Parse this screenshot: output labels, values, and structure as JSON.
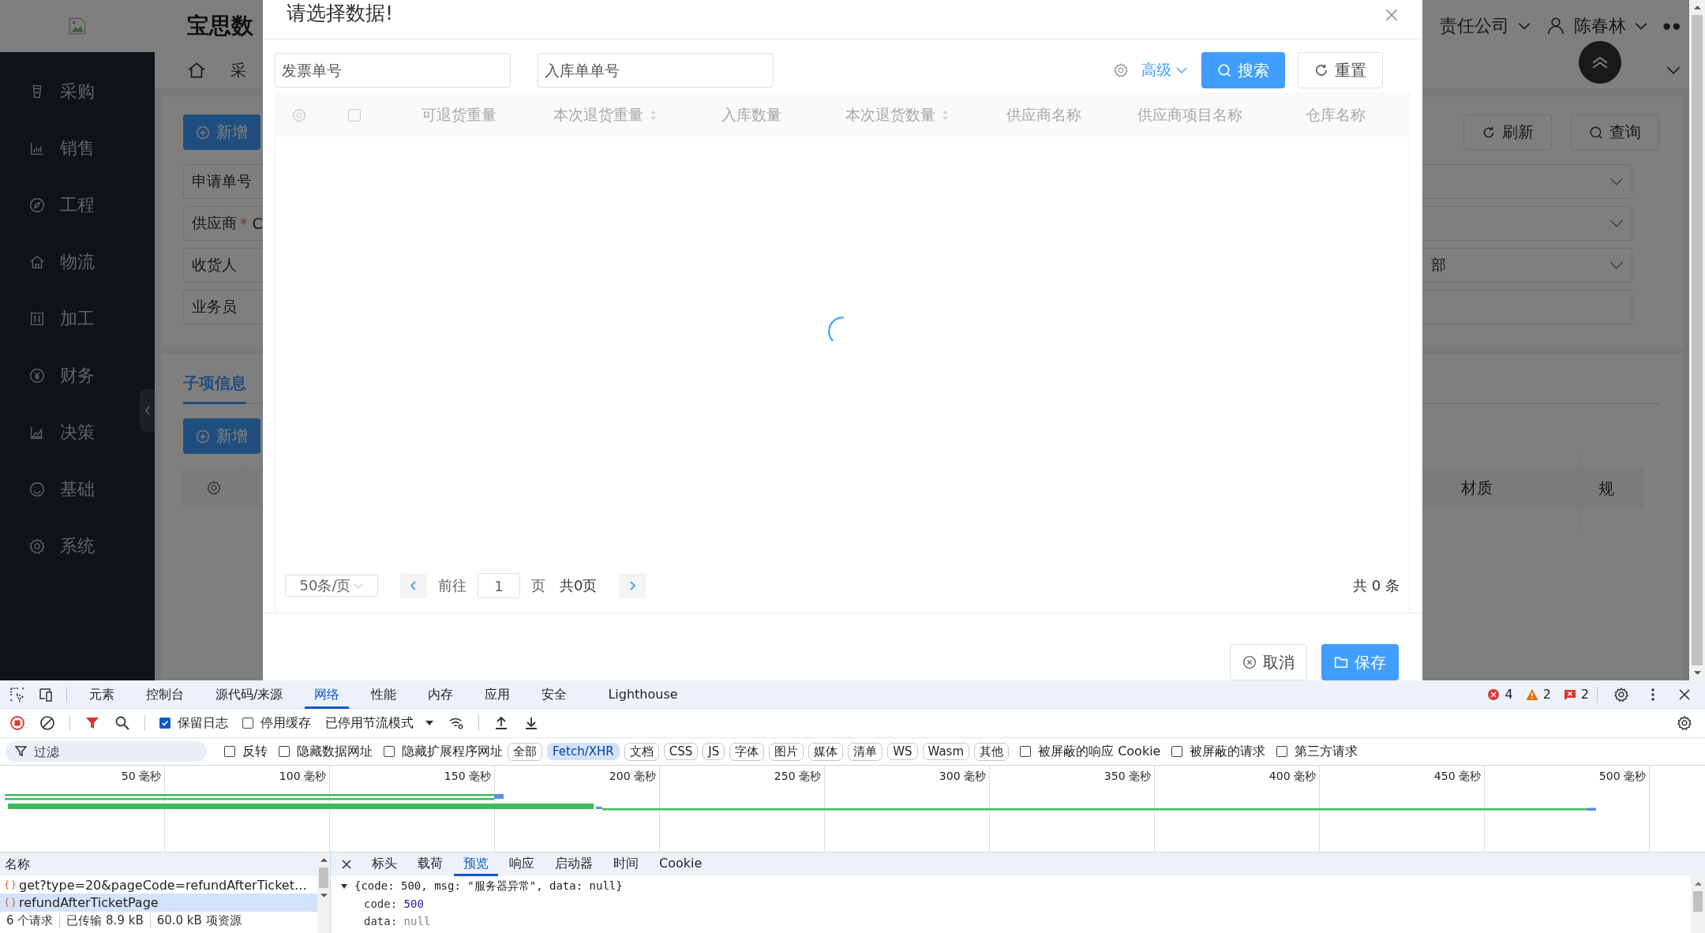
{
  "app": {
    "header": {
      "title": "宝思数",
      "company": "责任公司",
      "user": "陈春林"
    },
    "sidebar": {
      "items": [
        {
          "label": "采购"
        },
        {
          "label": "销售"
        },
        {
          "label": "工程"
        },
        {
          "label": "物流"
        },
        {
          "label": "加工"
        },
        {
          "label": "财务"
        },
        {
          "label": "决策"
        },
        {
          "label": "基础"
        },
        {
          "label": "系统"
        }
      ]
    },
    "tabs_bar": {
      "tabs": [
        {
          "label": "采"
        }
      ]
    },
    "form": {
      "add_button": "新增",
      "refresh_button": "刷新",
      "query_button": "查询",
      "required_mark": "*",
      "fields": [
        {
          "label": "申请单号",
          "required": false
        },
        {
          "label": "供应商",
          "required": true,
          "value": "C"
        },
        {
          "label": "收货人",
          "required": false
        },
        {
          "label": "业务员",
          "required": false
        }
      ],
      "right_fields": [
        {
          "kind": "select"
        },
        {
          "kind": "select"
        },
        {
          "kind": "select",
          "value": "部"
        },
        {
          "kind": "input"
        }
      ]
    },
    "sub_section": {
      "tabs": [
        {
          "label": "子项信息",
          "selected": true
        }
      ],
      "add_button": "新增",
      "columns": [
        "材质",
        "规"
      ]
    }
  },
  "dialog": {
    "title": "请选择数据!",
    "filters": [
      {
        "placeholder": "发票单号"
      },
      {
        "placeholder": "入库单单号"
      }
    ],
    "advanced": "高级",
    "search_button": "搜索",
    "reset_button": "重置",
    "table": {
      "loading": true,
      "select_all_checked": false,
      "columns": [
        {
          "label": "可退货重量",
          "sortable": false
        },
        {
          "label": "本次退货重量",
          "sortable": true
        },
        {
          "label": "入库数量",
          "sortable": false
        },
        {
          "label": "本次退货数量",
          "sortable": true
        },
        {
          "label": "供应商名称",
          "sortable": false
        },
        {
          "label": "供应商项目名称",
          "sortable": false
        },
        {
          "label": "仓库名称",
          "sortable": false
        }
      ]
    },
    "pagination": {
      "page_size": "50条/页",
      "goto": "前往",
      "page": "1",
      "page_unit": "页",
      "page_count": "共0页",
      "total": "共 0 条"
    },
    "buttons": [
      {
        "label": "取消",
        "kind": "default"
      },
      {
        "label": "保存",
        "kind": "primary"
      }
    ]
  },
  "devtools": {
    "tabs": [
      {
        "label": "元素",
        "selected": false
      },
      {
        "label": "控制台",
        "selected": false
      },
      {
        "label": "源代码/来源",
        "selected": false
      },
      {
        "label": "网络",
        "selected": true
      },
      {
        "label": "性能",
        "selected": false
      },
      {
        "label": "内存",
        "selected": false
      },
      {
        "label": "应用",
        "selected": false
      },
      {
        "label": "安全",
        "selected": false
      },
      {
        "label": "Lighthouse",
        "selected": false
      }
    ],
    "counts": {
      "errors": "4",
      "warnings": "2",
      "issues": "2"
    },
    "toolbar": {
      "options": [
        {
          "label": "保留日志",
          "checked": true
        },
        {
          "label": "停用缓存",
          "checked": false
        }
      ],
      "throttling": "已停用节流模式"
    },
    "filter": {
      "placeholder": "过滤",
      "options": [
        {
          "label": "反转",
          "checked": false
        },
        {
          "label": "隐藏数据网址",
          "checked": false
        },
        {
          "label": "隐藏扩展程序网址",
          "checked": false
        }
      ],
      "types": [
        {
          "label": "全部",
          "selected": false
        },
        {
          "label": "Fetch/XHR",
          "selected": true
        },
        {
          "label": "文档",
          "selected": false
        },
        {
          "label": "CSS",
          "selected": false
        },
        {
          "label": "JS",
          "selected": false
        },
        {
          "label": "字体",
          "selected": false
        },
        {
          "label": "图片",
          "selected": false
        },
        {
          "label": "媒体",
          "selected": false
        },
        {
          "label": "清单",
          "selected": false
        },
        {
          "label": "WS",
          "selected": false
        },
        {
          "label": "Wasm",
          "selected": false
        },
        {
          "label": "其他",
          "selected": false
        }
      ],
      "more_options": [
        {
          "label": "被屏蔽的响应 Cookie",
          "checked": false
        },
        {
          "label": "被屏蔽的请求",
          "checked": false
        },
        {
          "label": "第三方请求",
          "checked": false
        }
      ]
    },
    "timeline": {
      "ticks": [
        "50 毫秒",
        "100 毫秒",
        "150 毫秒",
        "200 毫秒",
        "250 毫秒",
        "300 毫秒",
        "350 毫秒",
        "400 毫秒",
        "450 毫秒",
        "500 毫秒"
      ]
    },
    "requests": {
      "header": "名称",
      "rows": [
        {
          "name": "get?type=20&pageCode=refundAfterTicket…",
          "selected": false
        },
        {
          "name": "refundAfterTicketPage",
          "selected": true
        }
      ],
      "summary": [
        "6 个请求",
        "已传输 8.9 kB",
        "60.0 kB 项资源"
      ]
    },
    "detail": {
      "tabs": [
        {
          "label": "标头",
          "selected": false
        },
        {
          "label": "载荷",
          "selected": false
        },
        {
          "label": "预览",
          "selected": true
        },
        {
          "label": "响应",
          "selected": false
        },
        {
          "label": "启动器",
          "selected": false
        },
        {
          "label": "时间",
          "selected": false
        },
        {
          "label": "Cookie",
          "selected": false
        }
      ],
      "summary": "{code: 500, msg: \"服务器异常\", data: null}",
      "lines": [
        {
          "key": "code:",
          "value": "500",
          "kind": "number"
        },
        {
          "key": "data:",
          "value": "null",
          "kind": "null"
        }
      ]
    }
  }
}
